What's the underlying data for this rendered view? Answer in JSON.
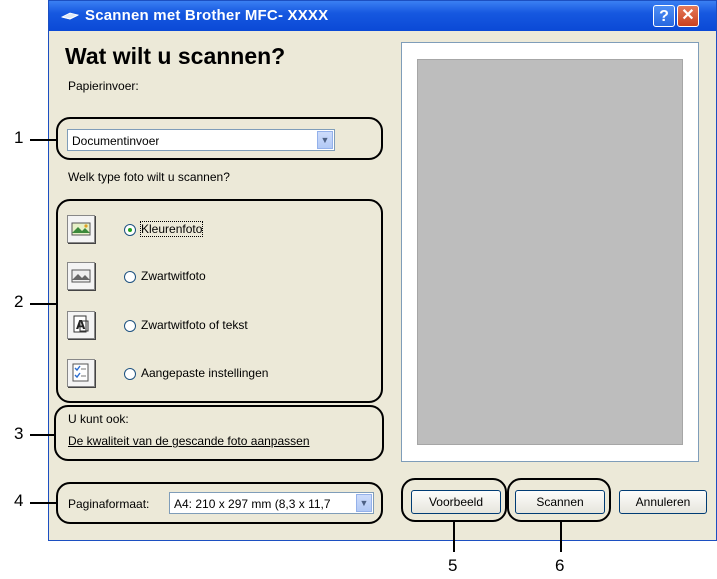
{
  "window": {
    "title": "Scannen met Brother MFC- XXXX",
    "help_label": "?",
    "close_label": "✕"
  },
  "main": {
    "heading": "Wat wilt u scannen?",
    "paper_source_label": "Papierinvoer:",
    "paper_source_value": "Documentinvoer",
    "photo_type_label": "Welk type foto wilt u scannen?",
    "options": [
      {
        "label": "Kleurenfoto",
        "selected": true,
        "icon": "color-photo-icon"
      },
      {
        "label": "Zwartwitfoto",
        "selected": false,
        "icon": "bw-photo-icon"
      },
      {
        "label": "Zwartwitfoto of tekst",
        "selected": false,
        "icon": "bw-text-icon"
      },
      {
        "label": "Aangepaste instellingen",
        "selected": false,
        "icon": "custom-settings-icon"
      }
    ],
    "also_label": "U kunt ook:",
    "quality_link": "De kwaliteit van de gescande foto aanpassen",
    "page_size_label": "Paginaformaat:",
    "page_size_value": "A4: 210 x 297 mm (8,3 x 11,7"
  },
  "buttons": {
    "preview": "Voorbeeld",
    "scan": "Scannen",
    "cancel": "Annuleren"
  },
  "callouts": [
    "1",
    "2",
    "3",
    "4",
    "5",
    "6"
  ],
  "colors": {
    "titlebar": "#0a49d6",
    "dialog_bg": "#ece9d8",
    "preview_area": "#bdbdbd",
    "radio_selected": "#21a121"
  }
}
